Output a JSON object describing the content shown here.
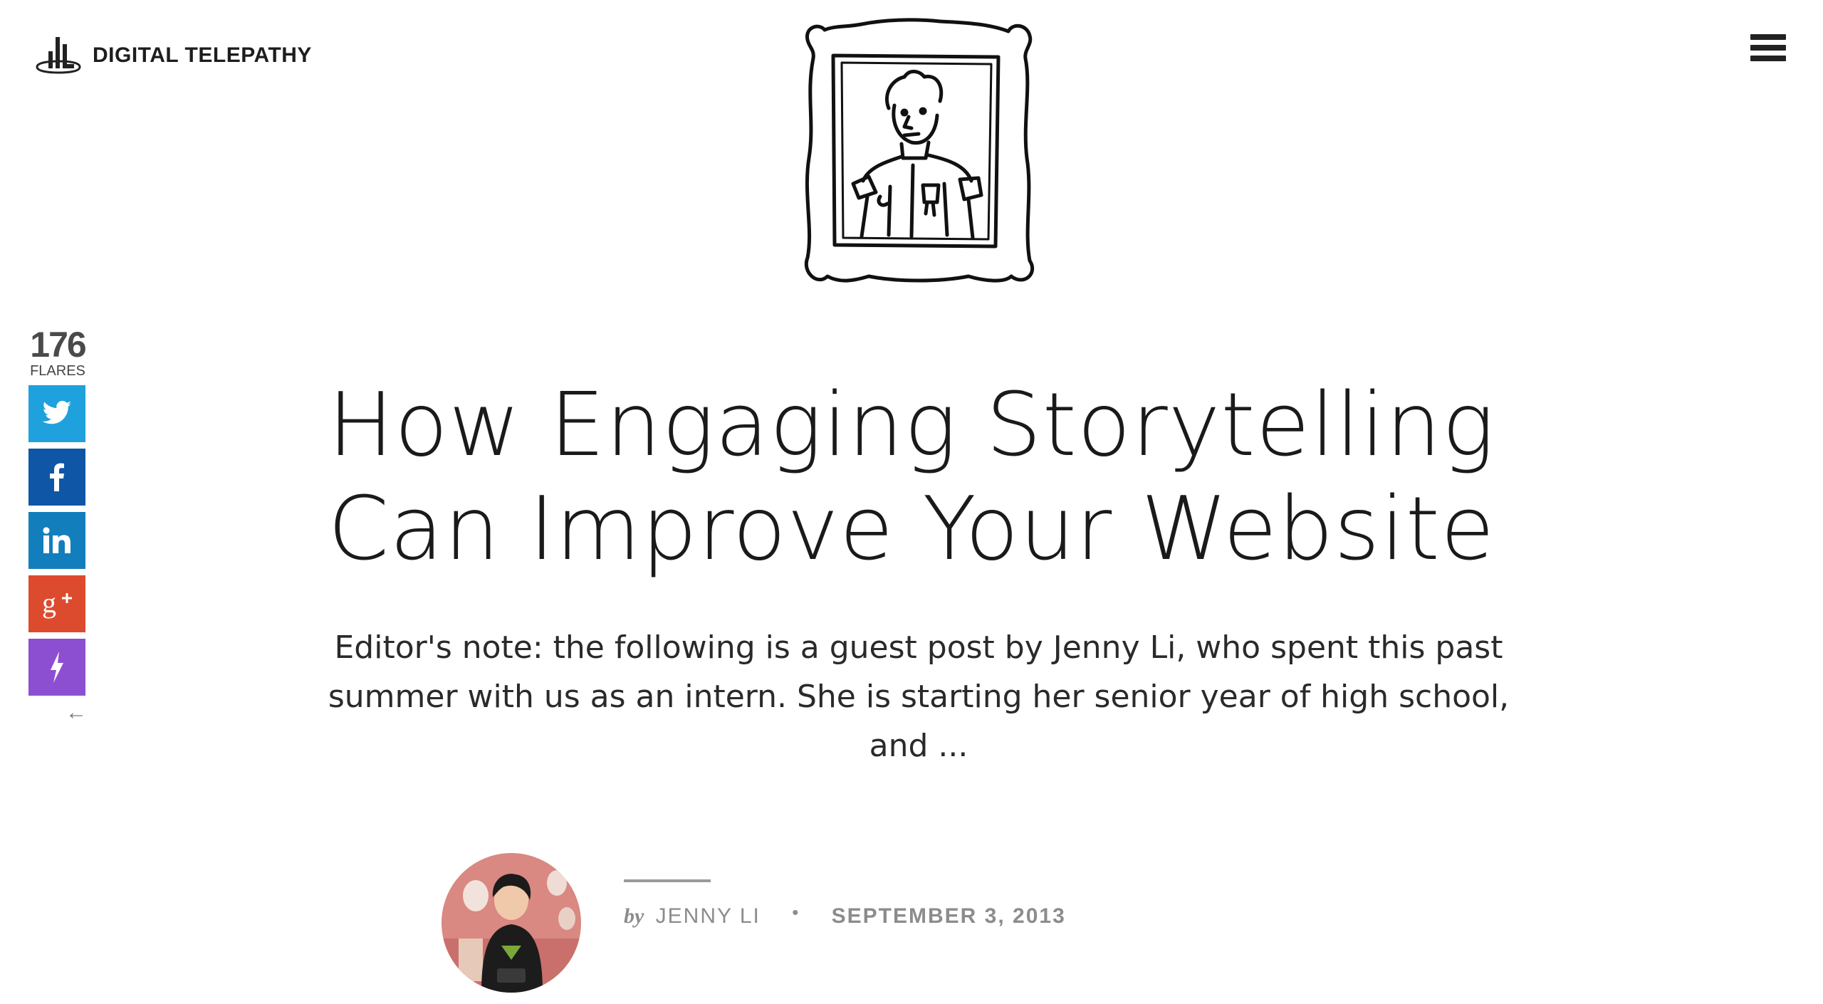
{
  "header": {
    "brand": "DIGITAL TELEPATHY",
    "logo_icon": "dt-logo-mark",
    "menu_icon": "hamburger-menu-icon"
  },
  "share": {
    "count": "176",
    "label": "FLARES",
    "buttons": [
      {
        "icon": "twitter-icon",
        "color": "#1ea1dc"
      },
      {
        "icon": "facebook-icon",
        "color": "#0f56a6"
      },
      {
        "icon": "linkedin-icon",
        "color": "#127ebc"
      },
      {
        "icon": "google-plus-icon",
        "color": "#dd4b2e"
      },
      {
        "icon": "flare-lightning-icon",
        "color": "#8d4fd1"
      }
    ],
    "collapse_glyph": "←"
  },
  "post": {
    "title": "How Engaging Storytelling Can Improve Your Website",
    "excerpt": "Editor's note: the following is a guest post by Jenny Li, who spent this past summer with us as an intern. She is starting her senior year of high school, and ...",
    "byline_prefix": "by",
    "author": "JENNY LI",
    "separator": "•",
    "date": "SEPTEMBER 3, 2013"
  }
}
